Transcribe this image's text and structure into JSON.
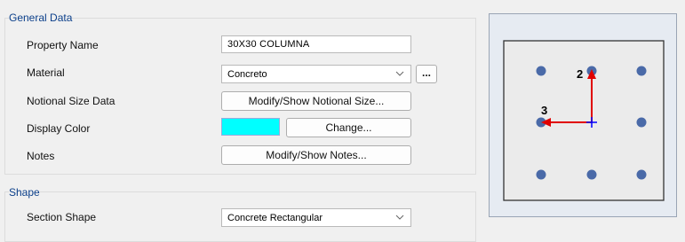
{
  "general": {
    "title": "General Data",
    "property_name": {
      "label": "Property Name",
      "value": "30X30 COLUMNA"
    },
    "material": {
      "label": "Material",
      "value": "Concreto",
      "more_label": "..."
    },
    "notional": {
      "label": "Notional Size Data",
      "button": "Modify/Show Notional Size..."
    },
    "display_color": {
      "label": "Display Color",
      "color": "#00ffff",
      "button": "Change..."
    },
    "notes": {
      "label": "Notes",
      "button": "Modify/Show Notes..."
    }
  },
  "shape": {
    "title": "Shape",
    "section_shape": {
      "label": "Section Shape",
      "value": "Concrete Rectangular"
    }
  },
  "preview": {
    "axis_2_label": "2",
    "axis_3_label": "3",
    "rebar_color": "#4a6aa8",
    "axis_color": "#e00000",
    "center_color": "#0000ff",
    "section_fill": "#ebebeb"
  }
}
